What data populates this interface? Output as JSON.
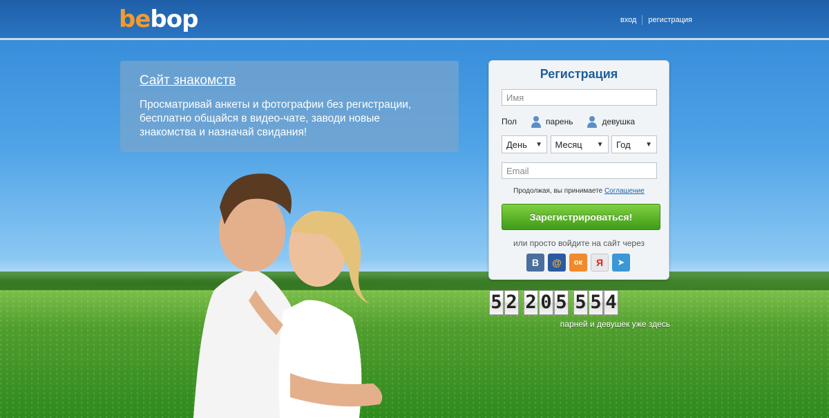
{
  "header": {
    "logo_part1": "be",
    "logo_part2": "bop",
    "login_link": "вход",
    "register_link": "регистрация"
  },
  "promo": {
    "title": "Сайт знакомств",
    "text": "Просматривай анкеты и фотографии без регистрации, бесплатно общайся в видео-чате, заводи новые знакомства и назначай свидания!"
  },
  "registration": {
    "title": "Регистрация",
    "name_placeholder": "Имя",
    "gender_label": "Пол",
    "gender_male": "парень",
    "gender_female": "девушка",
    "day_select": "День",
    "month_select": "Месяц",
    "year_select": "Год",
    "email_placeholder": "Email",
    "agreement_prefix": "Продолжая, вы принимаете",
    "agreement_link": "Соглашение",
    "submit_button": "Зарегистрироваться!",
    "social_text": "или просто войдите на сайт через"
  },
  "social": {
    "items": [
      {
        "name": "vk-icon",
        "glyph": "В",
        "color": "#4a6f9c"
      },
      {
        "name": "mailru-icon",
        "glyph": "@",
        "color": "#2c5aa0"
      },
      {
        "name": "odnoklassniki-icon",
        "glyph": "ок",
        "color": "#f2892b"
      },
      {
        "name": "yandex-icon",
        "glyph": "Я",
        "color": "#e8e8e8"
      },
      {
        "name": "telegram-icon",
        "glyph": "➤",
        "color": "#3b97d6"
      }
    ]
  },
  "counter": {
    "groups": [
      "52",
      "205",
      "554"
    ],
    "caption": "парней и девушек уже здесь"
  },
  "colors": {
    "header_blue": "#2a74c2",
    "brand_orange": "#f29b2f",
    "button_green": "#4fa826",
    "title_blue": "#1d5e9c"
  }
}
